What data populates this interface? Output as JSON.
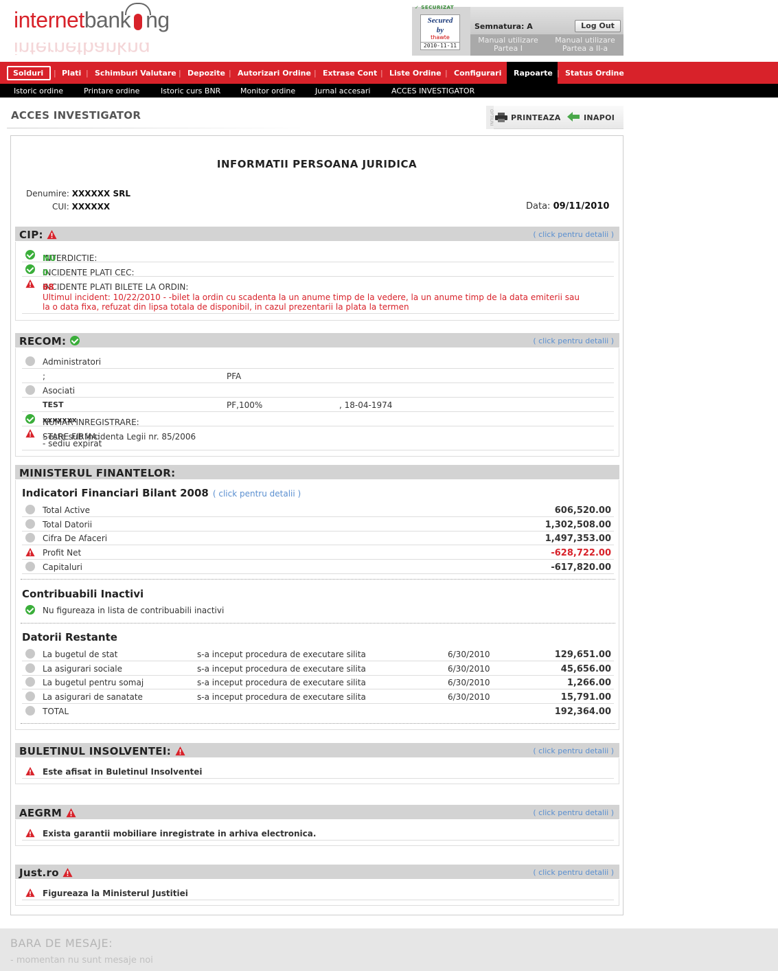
{
  "header": {
    "logo_part1": "internet",
    "logo_part2": "bank",
    "logo_part3": "ng",
    "security_top": "✓ SECURIZAT",
    "secured": "Secured",
    "by": "by",
    "thawte": "thawte",
    "security_date": "2010-11-11",
    "signature": "Semnatura: A",
    "logout": "Log Out",
    "manual1": "Manual utilizare Partea I",
    "manual2": "Manual utilizare Partea a II-a"
  },
  "nav": {
    "items": [
      "Solduri",
      "Plati",
      "Schimburi Valutare",
      "Depozite",
      "Autorizari Ordine",
      "Extrase Cont",
      "Liste Ordine",
      "Configurari",
      "Rapoarte",
      "Status Ordine"
    ]
  },
  "subnav": {
    "items": [
      "Istoric ordine",
      "Printare ordine",
      "Istoric curs BNR",
      "Monitor ordine",
      "Jurnal accesari",
      "ACCES INVESTIGATOR"
    ]
  },
  "page": {
    "title": "ACCES INVESTIGATOR",
    "tools_options": "OPTIUNI",
    "print": "PRINTEAZA",
    "back": "INAPOI"
  },
  "doc": {
    "title": "INFORMATII PERSOANA JURIDICA",
    "denumire_label": "Denumire:",
    "denumire_value": "XXXXXX SRL",
    "cui_label": "CUI:",
    "cui_value": "XXXXXX",
    "data_label": "Data:",
    "data_value": "09/11/2010"
  },
  "details_link": "( click pentru detalii )",
  "cip": {
    "title": "CIP:",
    "interdictie_label": "INTERDICTIE:",
    "interdictie_value": "NU",
    "cec_label": "INCIDENTE PLATI CEC:",
    "cec_value": "0",
    "bilete_label": "INCIDENTE PLATI BILETE LA ORDIN:",
    "bilete_value": "68",
    "incident_l1": "Ultimul incident: 10/22/2010 - -bilet la ordin cu scadenta la un anume timp de la vedere, la un anume timp de la data emiterii sau",
    "incident_l2": "la o data fixa, refuzat din lipsa totala de disponibil, in cazul prezentarii la plata la termen"
  },
  "recom": {
    "title": "RECOM:",
    "administratori": "Administratori",
    "adm_name": ";",
    "adm_type": "PFA",
    "asociati": "Asociati",
    "as_name": "TEST",
    "as_type": "PF,100%",
    "as_date": ", 18-04-1974",
    "nr_label": "NUMAR INREGISTRARE:",
    "nr_value": "xxxxxxx",
    "stare_label": "STARE FIRMA:",
    "stare_l1": "- este sub incidenta Legii nr. 85/2006",
    "stare_l2": "- sediu expirat"
  },
  "mf": {
    "title": "MINISTERUL FINANTELOR:",
    "bilant_title": "Indicatori Financiari Bilant 2008",
    "bilant_rows": [
      {
        "label": "Total Active",
        "value": "606,520.00"
      },
      {
        "label": "Total Datorii",
        "value": "1,302,508.00"
      },
      {
        "label": "Cifra De Afaceri",
        "value": "1,497,353.00"
      },
      {
        "label": "Profit Net",
        "value": "-628,722.00"
      },
      {
        "label": "Capitaluri",
        "value": "-617,820.00"
      }
    ],
    "inactivi_title": "Contribuabili Inactivi",
    "inactivi_text": "Nu figureaza in lista de contribuabili inactivi",
    "restante_title": "Datorii Restante",
    "restante_rows": [
      {
        "label": "La bugetul de stat",
        "status": "s-a inceput procedura de executare silita",
        "date": "6/30/2010",
        "value": "129,651.00"
      },
      {
        "label": "La asigurari sociale",
        "status": "s-a inceput procedura de executare silita",
        "date": "6/30/2010",
        "value": "45,656.00"
      },
      {
        "label": "La bugetul pentru somaj",
        "status": "s-a inceput procedura de executare silita",
        "date": "6/30/2010",
        "value": "1,266.00"
      },
      {
        "label": "La asigurari de sanatate",
        "status": "s-a inceput procedura de executare silita",
        "date": "6/30/2010",
        "value": "15,791.00"
      }
    ],
    "total_label": "TOTAL",
    "total_value": "192,364.00"
  },
  "insolv": {
    "title": "BULETINUL INSOLVENTEI:",
    "text": "Este afisat in Buletinul Insolventei"
  },
  "aegrm": {
    "title": "AEGRM",
    "text": "Exista garantii mobiliare inregistrate in arhiva electronica."
  },
  "just": {
    "title": "Just.ro",
    "text": "Figureaza la Ministerul Justitiei"
  },
  "messages": {
    "title": "BARA DE MESAJE:",
    "text": "- momentan nu sunt mesaje noi"
  },
  "colors": {
    "brand_red": "#d8222a",
    "ok_green": "#3aae3a",
    "link_blue": "#5a8fd0"
  }
}
